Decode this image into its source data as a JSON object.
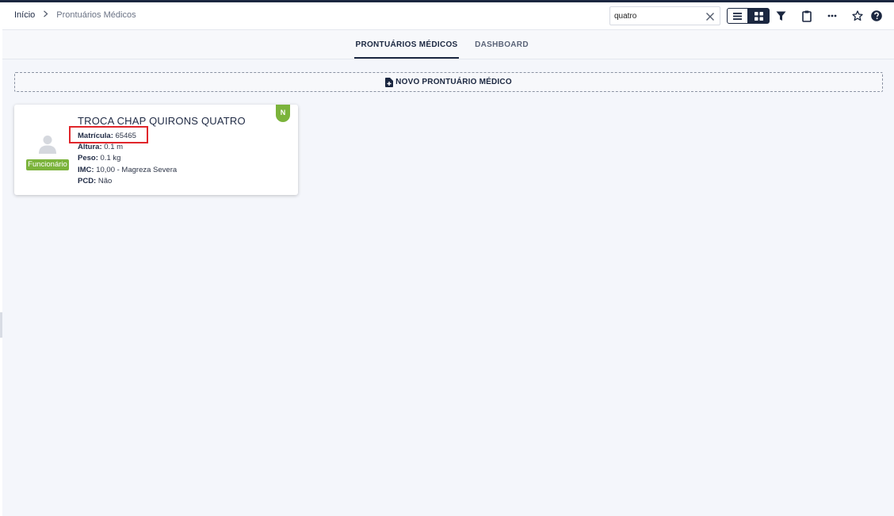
{
  "breadcrumb": {
    "home": "Início",
    "current": "Prontuários Médicos"
  },
  "search": {
    "value": "quatro",
    "placeholder": ""
  },
  "toolbar": {
    "icons": [
      "list-view-icon",
      "grid-view-icon",
      "filter-icon",
      "clipboard-icon",
      "more-icon",
      "star-icon",
      "help-icon"
    ],
    "active_view": "grid"
  },
  "tabs": [
    {
      "label": "PRONTUÁRIOS MÉDICOS",
      "active": true
    },
    {
      "label": "DASHBOARD",
      "active": false
    }
  ],
  "new_record": {
    "label": "NOVO PRONTUÁRIO MÉDICO"
  },
  "card": {
    "name": "TROCA CHAP QUIRONS QUATRO",
    "role": "Funcionário",
    "corner_badge": "N",
    "fields": {
      "matricula": {
        "label": "Matrícula:",
        "value": "65465"
      },
      "altura": {
        "label": "Altura:",
        "value": "0.1 m"
      },
      "peso": {
        "label": "Peso:",
        "value": "0.1 kg"
      },
      "imc": {
        "label": "IMC:",
        "value": "10,00 - Magreza Severa"
      },
      "pcd": {
        "label": "PCD:",
        "value": "Não"
      }
    }
  },
  "colors": {
    "primary": "#1b2740",
    "accent_green": "#7bb33b",
    "highlight_red": "#e0262b"
  }
}
